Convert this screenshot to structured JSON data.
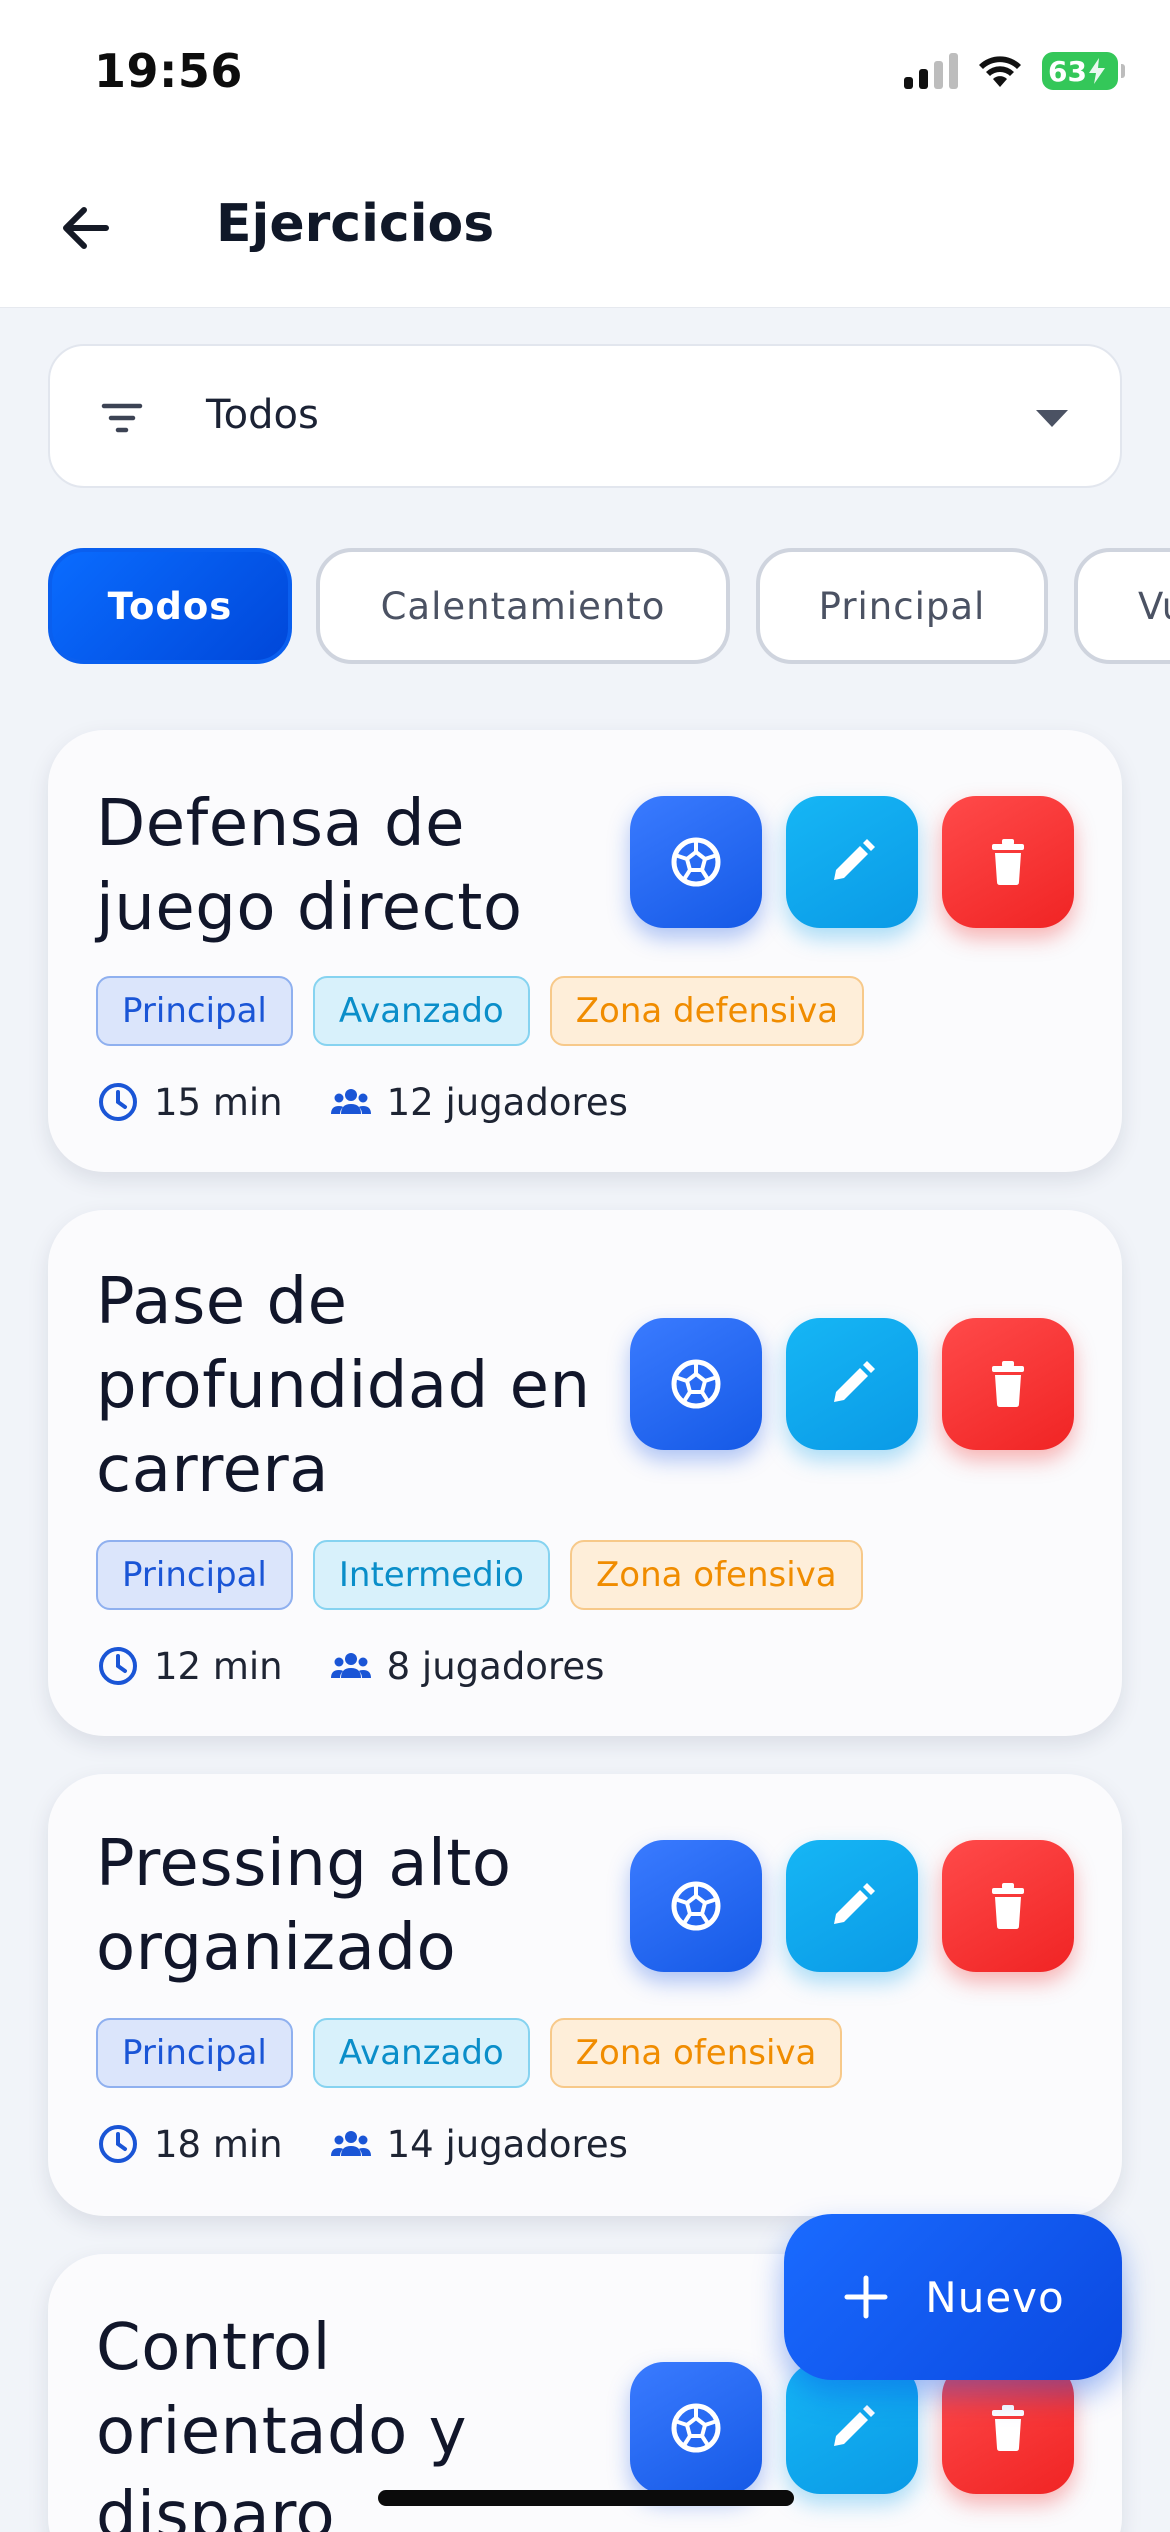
{
  "status_bar": {
    "time": "19:56",
    "battery": "63"
  },
  "header": {
    "title": "Ejercicios"
  },
  "filter": {
    "value": "Todos"
  },
  "chips": [
    {
      "label": "Todos",
      "active": true
    },
    {
      "label": "Calentamiento",
      "active": false
    },
    {
      "label": "Principal",
      "active": false
    },
    {
      "label": "Vu",
      "active": false
    }
  ],
  "cards": [
    {
      "title": "Defensa de juego directo",
      "tags": {
        "category": "Principal",
        "level": "Avanzado",
        "zone": "Zona defensiva"
      },
      "duration": "15 min",
      "players": "12 jugadores"
    },
    {
      "title": "Pase de profundidad en carrera",
      "tags": {
        "category": "Principal",
        "level": "Intermedio",
        "zone": "Zona ofensiva"
      },
      "duration": "12 min",
      "players": "8 jugadores"
    },
    {
      "title": "Pressing alto organizado",
      "tags": {
        "category": "Principal",
        "level": "Avanzado",
        "zone": "Zona ofensiva"
      },
      "duration": "18 min",
      "players": "14 jugadores"
    },
    {
      "title": "Control orientado y disparo"
    }
  ],
  "fab": {
    "label": "Nuevo"
  },
  "colors": {
    "primary": "#0a5fef",
    "edit": "#0ea5e9",
    "delete": "#f02424",
    "tag_category": "#1a55d6",
    "tag_level": "#0a8ec9",
    "tag_zone": "#f08c00"
  }
}
